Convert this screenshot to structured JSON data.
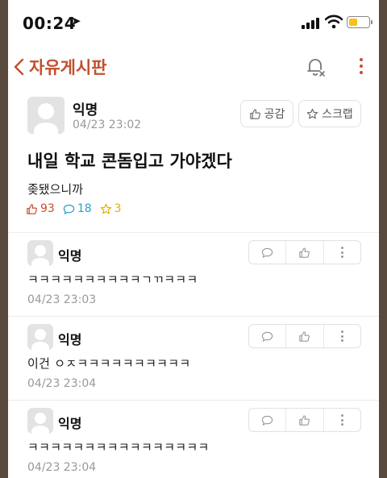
{
  "status_bar": {
    "time": "00:24",
    "battery_level": 0.45,
    "colors": {
      "battery": "#f4c21b"
    }
  },
  "nav": {
    "title": "자유게시판",
    "icons": [
      "chevron-left-icon",
      "bell-off-icon",
      "more-vertical-icon"
    ],
    "accent_color": "#c2502f"
  },
  "post": {
    "author": "익명",
    "date": "04/23 23:02",
    "like_button_label": "공감",
    "scrap_button_label": "스크랩",
    "title": "내일 학교 콘돔입고 가야겠다",
    "body": "좆됐으니까",
    "stats": {
      "likes": "93",
      "comments": "18",
      "scraps": "3"
    },
    "colors": {
      "likes": "#c2502f",
      "comments": "#2b9ec4",
      "scraps": "#e0b200"
    }
  },
  "comments": [
    {
      "author": "익명",
      "text": "ㅋㅋㅋㅋㅋㅋㅋㅋㅋㅋㄱㄲㅋㅋㅋ",
      "date": "04/23 23:03"
    },
    {
      "author": "익명",
      "text": "이건 ㅇㅈㅋㅋㅋㅋㅋㅋㅋㅋㅋㅋ",
      "date": "04/23 23:04"
    },
    {
      "author": "익명",
      "text": "ㅋㅋㅋㅋㅋㅋㅋㅋㅋㅋㅋㅋㅋㅋㅋㅋ",
      "date": "04/23 23:04"
    }
  ]
}
